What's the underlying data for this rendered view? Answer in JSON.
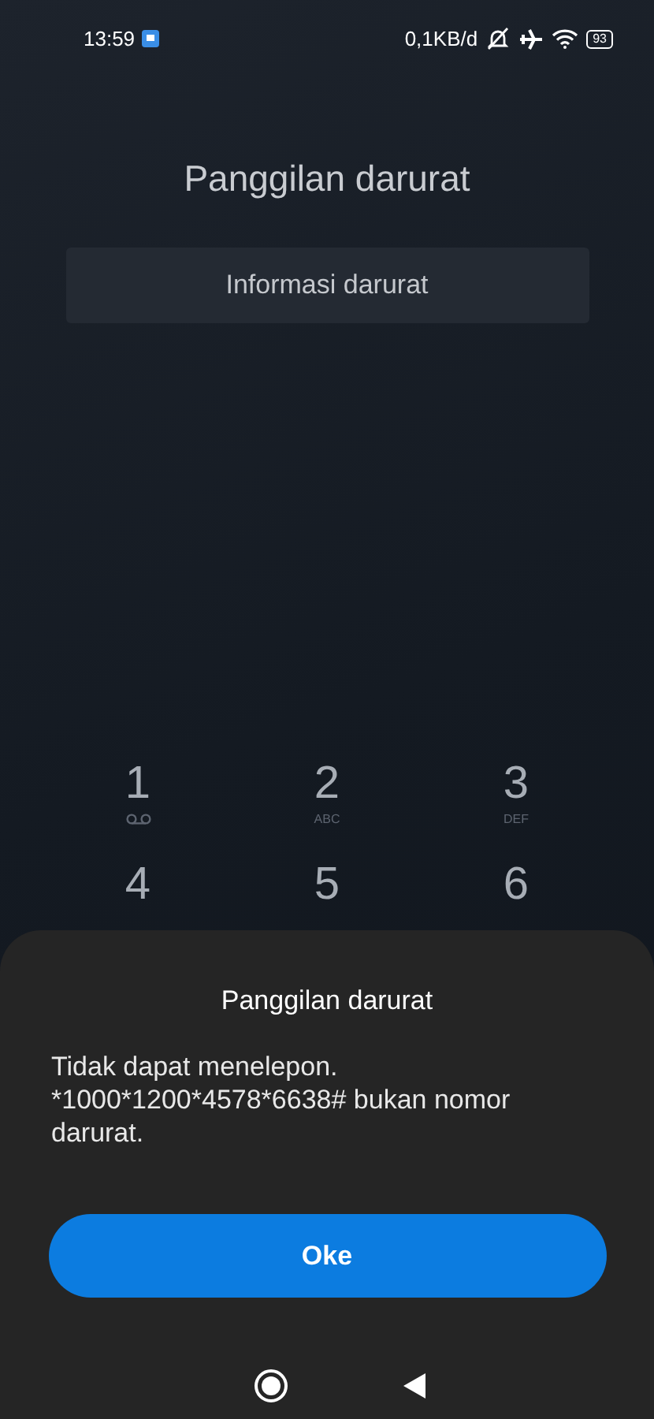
{
  "status_bar": {
    "time": "13:59",
    "speed": "0,1KB/d",
    "battery": "93"
  },
  "title": "Panggilan darurat",
  "info_button": "Informasi darurat",
  "keypad": [
    {
      "digit": "1",
      "kind": "voicemail"
    },
    {
      "digit": "2",
      "letters": "ABC",
      "kind": "letters"
    },
    {
      "digit": "3",
      "letters": "DEF",
      "kind": "letters"
    },
    {
      "digit": "4",
      "kind": "plain"
    },
    {
      "digit": "5",
      "kind": "plain"
    },
    {
      "digit": "6",
      "kind": "plain"
    }
  ],
  "dialog": {
    "title": "Panggilan darurat",
    "message": "Tidak dapat menelepon. *1000*1200*4578*6638# bukan nomor darurat.",
    "button": "Oke"
  }
}
